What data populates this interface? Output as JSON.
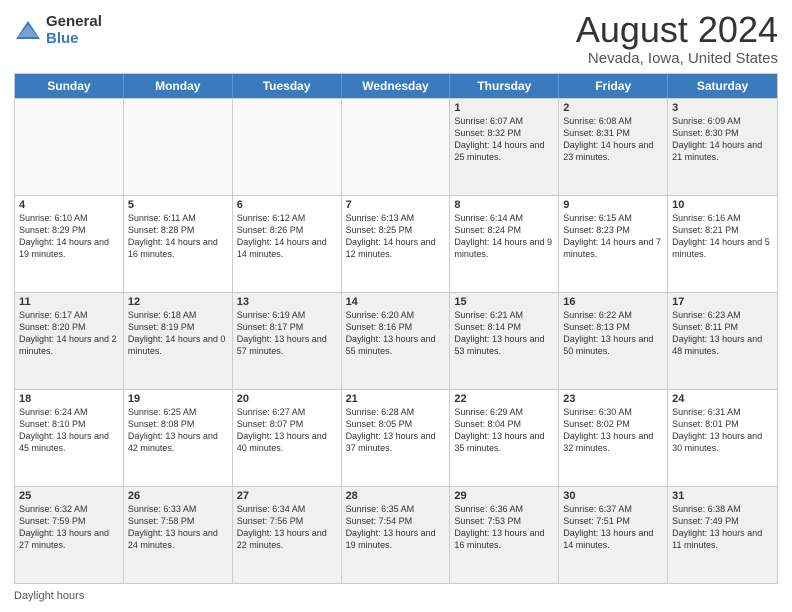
{
  "header": {
    "logo_general": "General",
    "logo_blue": "Blue",
    "title": "August 2024",
    "subtitle": "Nevada, Iowa, United States"
  },
  "weekdays": [
    "Sunday",
    "Monday",
    "Tuesday",
    "Wednesday",
    "Thursday",
    "Friday",
    "Saturday"
  ],
  "footer": {
    "daylight_label": "Daylight hours"
  },
  "rows": [
    [
      {
        "day": "",
        "info": ""
      },
      {
        "day": "",
        "info": ""
      },
      {
        "day": "",
        "info": ""
      },
      {
        "day": "",
        "info": ""
      },
      {
        "day": "1",
        "info": "Sunrise: 6:07 AM\nSunset: 8:32 PM\nDaylight: 14 hours and 25 minutes."
      },
      {
        "day": "2",
        "info": "Sunrise: 6:08 AM\nSunset: 8:31 PM\nDaylight: 14 hours and 23 minutes."
      },
      {
        "day": "3",
        "info": "Sunrise: 6:09 AM\nSunset: 8:30 PM\nDaylight: 14 hours and 21 minutes."
      }
    ],
    [
      {
        "day": "4",
        "info": "Sunrise: 6:10 AM\nSunset: 8:29 PM\nDaylight: 14 hours and 19 minutes."
      },
      {
        "day": "5",
        "info": "Sunrise: 6:11 AM\nSunset: 8:28 PM\nDaylight: 14 hours and 16 minutes."
      },
      {
        "day": "6",
        "info": "Sunrise: 6:12 AM\nSunset: 8:26 PM\nDaylight: 14 hours and 14 minutes."
      },
      {
        "day": "7",
        "info": "Sunrise: 6:13 AM\nSunset: 8:25 PM\nDaylight: 14 hours and 12 minutes."
      },
      {
        "day": "8",
        "info": "Sunrise: 6:14 AM\nSunset: 8:24 PM\nDaylight: 14 hours and 9 minutes."
      },
      {
        "day": "9",
        "info": "Sunrise: 6:15 AM\nSunset: 8:23 PM\nDaylight: 14 hours and 7 minutes."
      },
      {
        "day": "10",
        "info": "Sunrise: 6:16 AM\nSunset: 8:21 PM\nDaylight: 14 hours and 5 minutes."
      }
    ],
    [
      {
        "day": "11",
        "info": "Sunrise: 6:17 AM\nSunset: 8:20 PM\nDaylight: 14 hours and 2 minutes."
      },
      {
        "day": "12",
        "info": "Sunrise: 6:18 AM\nSunset: 8:19 PM\nDaylight: 14 hours and 0 minutes."
      },
      {
        "day": "13",
        "info": "Sunrise: 6:19 AM\nSunset: 8:17 PM\nDaylight: 13 hours and 57 minutes."
      },
      {
        "day": "14",
        "info": "Sunrise: 6:20 AM\nSunset: 8:16 PM\nDaylight: 13 hours and 55 minutes."
      },
      {
        "day": "15",
        "info": "Sunrise: 6:21 AM\nSunset: 8:14 PM\nDaylight: 13 hours and 53 minutes."
      },
      {
        "day": "16",
        "info": "Sunrise: 6:22 AM\nSunset: 8:13 PM\nDaylight: 13 hours and 50 minutes."
      },
      {
        "day": "17",
        "info": "Sunrise: 6:23 AM\nSunset: 8:11 PM\nDaylight: 13 hours and 48 minutes."
      }
    ],
    [
      {
        "day": "18",
        "info": "Sunrise: 6:24 AM\nSunset: 8:10 PM\nDaylight: 13 hours and 45 minutes."
      },
      {
        "day": "19",
        "info": "Sunrise: 6:25 AM\nSunset: 8:08 PM\nDaylight: 13 hours and 42 minutes."
      },
      {
        "day": "20",
        "info": "Sunrise: 6:27 AM\nSunset: 8:07 PM\nDaylight: 13 hours and 40 minutes."
      },
      {
        "day": "21",
        "info": "Sunrise: 6:28 AM\nSunset: 8:05 PM\nDaylight: 13 hours and 37 minutes."
      },
      {
        "day": "22",
        "info": "Sunrise: 6:29 AM\nSunset: 8:04 PM\nDaylight: 13 hours and 35 minutes."
      },
      {
        "day": "23",
        "info": "Sunrise: 6:30 AM\nSunset: 8:02 PM\nDaylight: 13 hours and 32 minutes."
      },
      {
        "day": "24",
        "info": "Sunrise: 6:31 AM\nSunset: 8:01 PM\nDaylight: 13 hours and 30 minutes."
      }
    ],
    [
      {
        "day": "25",
        "info": "Sunrise: 6:32 AM\nSunset: 7:59 PM\nDaylight: 13 hours and 27 minutes."
      },
      {
        "day": "26",
        "info": "Sunrise: 6:33 AM\nSunset: 7:58 PM\nDaylight: 13 hours and 24 minutes."
      },
      {
        "day": "27",
        "info": "Sunrise: 6:34 AM\nSunset: 7:56 PM\nDaylight: 13 hours and 22 minutes."
      },
      {
        "day": "28",
        "info": "Sunrise: 6:35 AM\nSunset: 7:54 PM\nDaylight: 13 hours and 19 minutes."
      },
      {
        "day": "29",
        "info": "Sunrise: 6:36 AM\nSunset: 7:53 PM\nDaylight: 13 hours and 16 minutes."
      },
      {
        "day": "30",
        "info": "Sunrise: 6:37 AM\nSunset: 7:51 PM\nDaylight: 13 hours and 14 minutes."
      },
      {
        "day": "31",
        "info": "Sunrise: 6:38 AM\nSunset: 7:49 PM\nDaylight: 13 hours and 11 minutes."
      }
    ]
  ]
}
